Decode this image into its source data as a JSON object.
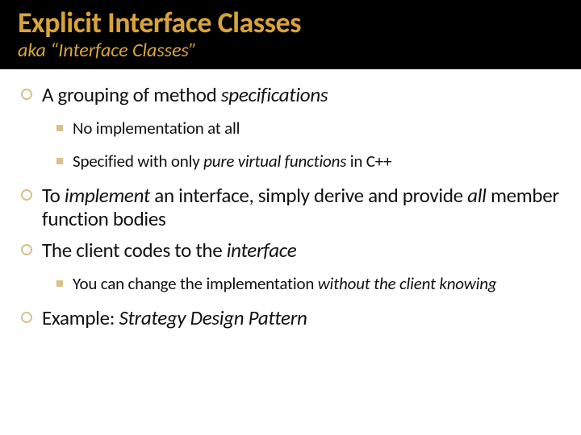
{
  "header": {
    "title": "Explicit Interface Classes",
    "subtitle_prefix": "aka ",
    "subtitle_quoted": "“Interface Classes”"
  },
  "bullets": {
    "b1_pre": "A grouping of method ",
    "b1_em": "specifications",
    "b1_sub1": "No implementation at all",
    "b1_sub2_pre": "Specified with only ",
    "b1_sub2_em": "pure virtual functions",
    "b1_sub2_post": " in C++",
    "b2_pre": "To ",
    "b2_em1": "implement",
    "b2_mid": " an interface, simply derive and provide ",
    "b2_em2": "all",
    "b2_post": " member function bodies",
    "b3_pre": "The client codes to the ",
    "b3_em": "interface",
    "b3_sub1_pre": "You can change the implementation ",
    "b3_sub1_em": "without the client knowing",
    "b4_pre": "Example: ",
    "b4_em": "Strategy Design Pattern"
  }
}
